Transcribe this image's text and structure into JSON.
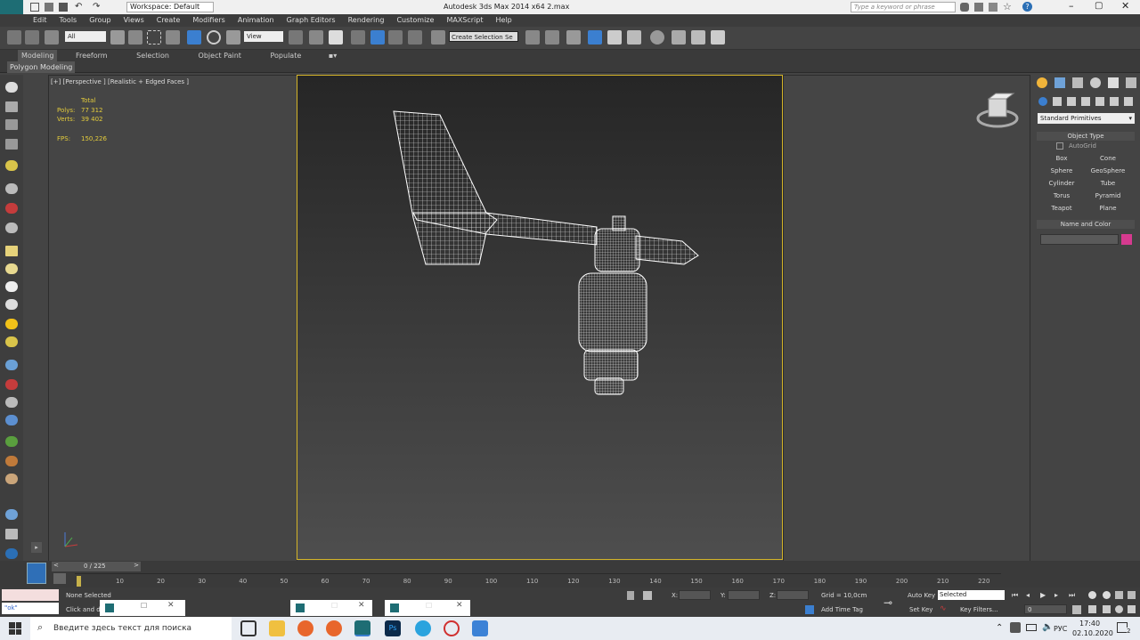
{
  "titlebar": {
    "workspace": "Workspace: Default",
    "title": "Autodesk 3ds Max  2014 x64     2.max",
    "search_placeholder": "Type a keyword or phrase"
  },
  "menu": [
    "Edit",
    "Tools",
    "Group",
    "Views",
    "Create",
    "Modifiers",
    "Animation",
    "Graph Editors",
    "Rendering",
    "Customize",
    "MAXScript",
    "Help"
  ],
  "toolbar": {
    "filter_value": "All",
    "view_value": "View",
    "selection_set": "Create Selection Se"
  },
  "ribbon": {
    "tabs": [
      "Modeling",
      "Freeform",
      "Selection",
      "Object Paint",
      "Populate"
    ],
    "subtab": "Polygon Modeling"
  },
  "viewport": {
    "label": "[+] [Perspective ] [Realistic + Edged Faces ]",
    "stats_header": "Total",
    "polys_label": "Polys:",
    "polys_value": "77 312",
    "verts_label": "Verts:",
    "verts_value": "39 402",
    "fps_label": "FPS:",
    "fps_value": "150,226"
  },
  "panel": {
    "dropdown": "Standard Primitives",
    "object_type": "Object Type",
    "autogrid": "AutoGrid",
    "buttons": [
      "Box",
      "Cone",
      "Sphere",
      "GeoSphere",
      "Cylinder",
      "Tube",
      "Torus",
      "Pyramid",
      "Teapot",
      "Plane"
    ],
    "name_and_color": "Name and Color",
    "color": "#d63a8f"
  },
  "timeline": {
    "frame_counter": "0 / 225",
    "ticks": [
      "10",
      "20",
      "30",
      "40",
      "50",
      "60",
      "70",
      "80",
      "90",
      "100",
      "110",
      "120",
      "130",
      "140",
      "150",
      "160",
      "170",
      "180",
      "190",
      "200",
      "210",
      "220"
    ]
  },
  "status": {
    "script_value": "\"ok\"",
    "none_selected": "None Selected",
    "prompt": "Click and dr",
    "x_label": "X:",
    "y_label": "Y:",
    "z_label": "Z:",
    "grid": "Grid = 10,0cm",
    "add_time_tag": "Add Time Tag",
    "auto_key": "Auto Key",
    "set_key": "Set Key",
    "selected": "Selected",
    "key_filters": "Key Filters...",
    "frame_field": "0"
  },
  "taskbar": {
    "search_placeholder": "Введите здесь текст для поиска",
    "lang": "РУС",
    "time": "17:40",
    "date": "02.10.2020",
    "notification_count": "2"
  }
}
